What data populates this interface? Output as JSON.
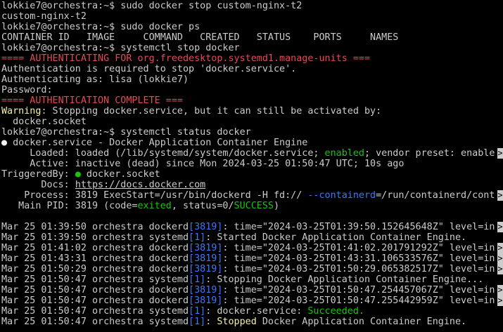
{
  "colors": {
    "background": "#000000",
    "text": "#cccccc",
    "red": "#e74856",
    "yellow": "#f9f1a5",
    "green": "#16c60c",
    "blue": "#3b78ff"
  },
  "truncation_marker": ">",
  "lines": [
    {
      "segments": [
        {
          "t": "lokkie7@orchestra:~$ sudo docker stop custom-nginx-t2"
        }
      ]
    },
    {
      "segments": [
        {
          "t": "custom-nginx-t2"
        }
      ]
    },
    {
      "segments": [
        {
          "t": "lokkie7@orchestra:~$ sudo docker ps"
        }
      ]
    },
    {
      "segments": [
        {
          "t": "CONTAINER ID   IMAGE     COMMAND   CREATED   STATUS    PORTS     NAMES"
        }
      ]
    },
    {
      "segments": [
        {
          "t": "lokkie7@orchestra:~$ systemctl stop docker"
        }
      ]
    },
    {
      "segments": [
        {
          "t": "==== AUTHENTICATING FOR org.freedesktop.systemd1.manage-units ===",
          "c": "red"
        }
      ]
    },
    {
      "segments": [
        {
          "t": "Authentication is required to stop 'docker.service'."
        }
      ]
    },
    {
      "segments": [
        {
          "t": "Authenticating as: lisa (lokkie7)"
        }
      ]
    },
    {
      "segments": [
        {
          "t": "Password:"
        }
      ]
    },
    {
      "segments": [
        {
          "t": "==== AUTHENTICATION COMPLETE ===",
          "c": "red"
        }
      ]
    },
    {
      "segments": [
        {
          "t": "Warning",
          "c": "yellow"
        },
        {
          "t": ": Stopping docker.service, but it can still be activated by:"
        }
      ]
    },
    {
      "segments": [
        {
          "t": "  docker.socket"
        }
      ]
    },
    {
      "segments": [
        {
          "t": "lokkie7@orchestra:~$ systemctl status docker"
        }
      ]
    },
    {
      "segments": [
        {
          "t": "●",
          "c": "white"
        },
        {
          "t": " docker.service - Docker Application Container Engine"
        }
      ]
    },
    {
      "trunc": true,
      "segments": [
        {
          "t": "     Loaded: loaded (/lib/systemd/system/docker.service; "
        },
        {
          "t": "enabled",
          "c": "green"
        },
        {
          "t": "; vendor preset: enable"
        }
      ]
    },
    {
      "segments": [
        {
          "t": "     Active: inactive (dead) since Mon 2024-03-25 01:50:47 UTC; 10s ago"
        }
      ]
    },
    {
      "segments": [
        {
          "t": "TriggeredBy: "
        },
        {
          "t": "●",
          "c": "green"
        },
        {
          "t": " docker.socket"
        }
      ]
    },
    {
      "segments": [
        {
          "t": "       Docs: "
        },
        {
          "t": "https://docs.docker.com",
          "c": "link"
        }
      ]
    },
    {
      "trunc": true,
      "segments": [
        {
          "t": "    Process: 3819 ExecStart=/usr/bin/dockerd -H fd:// "
        },
        {
          "t": "--containerd",
          "c": "blue"
        },
        {
          "t": "=/run/containerd/cont"
        }
      ]
    },
    {
      "segments": [
        {
          "t": "   Main PID: 3819 (code="
        },
        {
          "t": "exited",
          "c": "green"
        },
        {
          "t": ", status=0/"
        },
        {
          "t": "SUCCESS",
          "c": "green"
        },
        {
          "t": ")"
        }
      ]
    },
    {
      "segments": [
        {
          "t": ""
        }
      ]
    },
    {
      "trunc": true,
      "segments": [
        {
          "t": "Mar 25 01:39:50 orchestra dockerd"
        },
        {
          "t": "[3819]",
          "c": "blue"
        },
        {
          "t": ": time=\"2024-03-25T01:39:50.152645648Z\" level=in"
        }
      ]
    },
    {
      "segments": [
        {
          "t": "Mar 25 01:39:50 orchestra systemd"
        },
        {
          "t": "[1]",
          "c": "blue"
        },
        {
          "t": ": Started Docker Application Container Engine."
        }
      ]
    },
    {
      "trunc": true,
      "segments": [
        {
          "t": "Mar 25 01:41:02 orchestra dockerd"
        },
        {
          "t": "[3819]",
          "c": "blue"
        },
        {
          "t": ": time=\"2024-03-25T01:41:02.201791292Z\" level=in"
        }
      ]
    },
    {
      "trunc": true,
      "segments": [
        {
          "t": "Mar 25 01:43:31 orchestra dockerd"
        },
        {
          "t": "[3819]",
          "c": "blue"
        },
        {
          "t": ": time=\"2024-03-25T01:43:31.106533576Z\" level=in"
        }
      ]
    },
    {
      "trunc": true,
      "segments": [
        {
          "t": "Mar 25 01:50:29 orchestra dockerd"
        },
        {
          "t": "[3819]",
          "c": "blue"
        },
        {
          "t": ": time=\"2024-03-25T01:50:29.065382517Z\" level=in"
        }
      ]
    },
    {
      "segments": [
        {
          "t": "Mar 25 01:50:47 orchestra systemd"
        },
        {
          "t": "[1]",
          "c": "blue"
        },
        {
          "t": ": Stopping Docker Application Container Engine..."
        }
      ]
    },
    {
      "trunc": true,
      "segments": [
        {
          "t": "Mar 25 01:50:47 orchestra dockerd"
        },
        {
          "t": "[3819]",
          "c": "blue"
        },
        {
          "t": ": time=\"2024-03-25T01:50:47.254457067Z\" level=in"
        }
      ]
    },
    {
      "trunc": true,
      "segments": [
        {
          "t": "Mar 25 01:50:47 orchestra dockerd"
        },
        {
          "t": "[3819]",
          "c": "blue"
        },
        {
          "t": ": time=\"2024-03-25T01:50:47.255442959Z\" level=in"
        }
      ]
    },
    {
      "segments": [
        {
          "t": "Mar 25 01:50:47 orchestra systemd"
        },
        {
          "t": "[1]",
          "c": "blue"
        },
        {
          "t": ": docker.service: "
        },
        {
          "t": "Succeeded.",
          "c": "green"
        }
      ]
    },
    {
      "segments": [
        {
          "t": "Mar 25 01:50:47 orchestra systemd"
        },
        {
          "t": "[1]",
          "c": "blue"
        },
        {
          "t": ": "
        },
        {
          "t": "Stopped",
          "c": "yellow"
        },
        {
          "t": " Docker Application Container Engine."
        }
      ]
    }
  ]
}
